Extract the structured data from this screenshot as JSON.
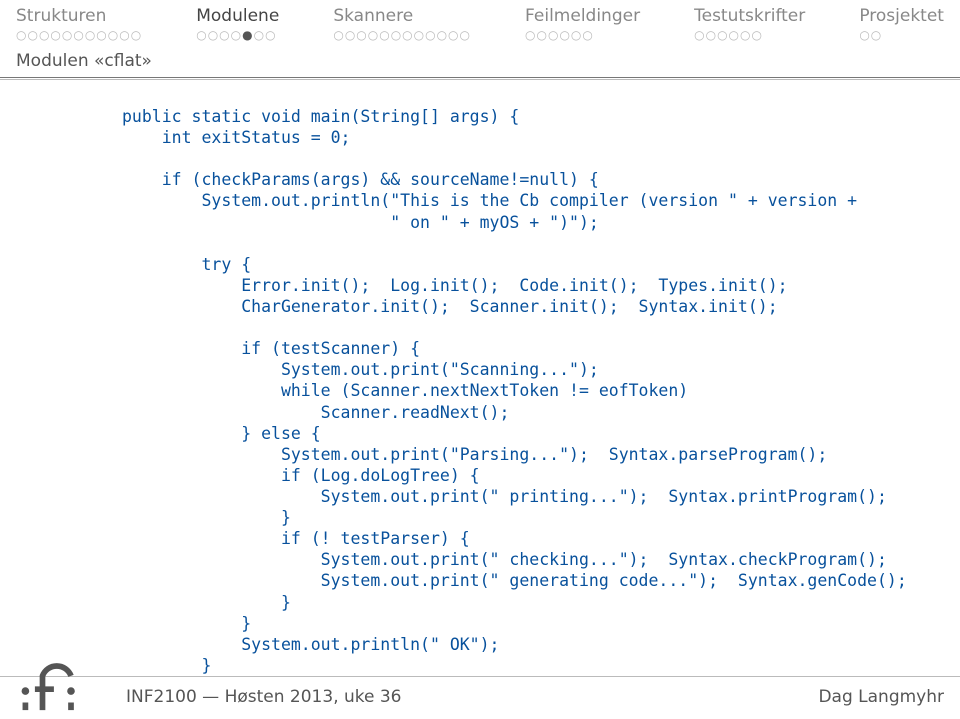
{
  "tabs": [
    {
      "label": "Strukturen",
      "active": false,
      "total": 11,
      "done": 0,
      "current": -1
    },
    {
      "label": "Modulene",
      "active": true,
      "total": 7,
      "done": 4,
      "current": 4
    },
    {
      "label": "Skannere",
      "active": false,
      "total": 12,
      "done": 0,
      "current": -1
    },
    {
      "label": "Feilmeldinger",
      "active": false,
      "total": 6,
      "done": 0,
      "current": -1
    },
    {
      "label": "Testutskrifter",
      "active": false,
      "total": 6,
      "done": 0,
      "current": -1
    },
    {
      "label": "Prosjektet",
      "active": false,
      "total": 2,
      "done": 0,
      "current": -1
    }
  ],
  "section_title": "Modulen «cflat»",
  "code": "public static void main(String[] args) {\n    int exitStatus = 0;\n\n    if (checkParams(args) && sourceName!=null) {\n        System.out.println(\"This is the Cb compiler (version \" + version +\n                           \" on \" + myOS + \")\");\n\n        try {\n            Error.init();  Log.init();  Code.init();  Types.init();\n            CharGenerator.init();  Scanner.init();  Syntax.init();\n\n            if (testScanner) {\n                System.out.print(\"Scanning...\");\n                while (Scanner.nextNextToken != eofToken)\n                    Scanner.readNext();\n            } else {\n                System.out.print(\"Parsing...\");  Syntax.parseProgram();\n                if (Log.doLogTree) {\n                    System.out.print(\" printing...\");  Syntax.printProgram();\n                }\n                if (! testParser) {\n                    System.out.print(\" checking...\");  Syntax.checkProgram();\n                    System.out.print(\" generating code...\");  Syntax.genCode();\n                }\n            }\n            System.out.println(\" OK\");\n        }",
  "footer": {
    "course": "INF2100 — Høsten 2013, uke 36",
    "author": "Dag Langmyhr"
  }
}
